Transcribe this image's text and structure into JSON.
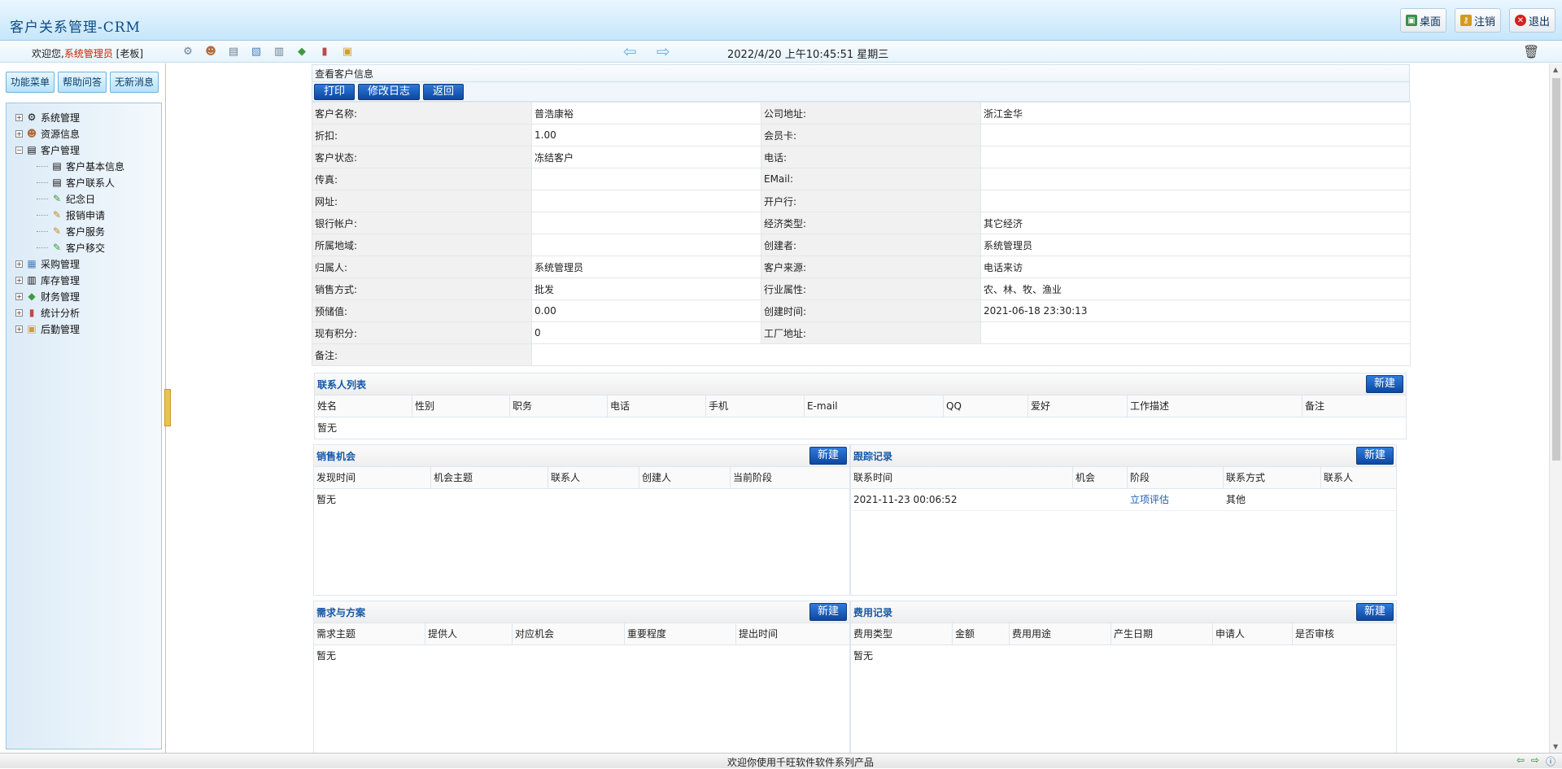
{
  "app": {
    "title": "客户关系管理-CRM"
  },
  "top_buttons": [
    {
      "label": "桌面",
      "icon": "desktop-icon",
      "color": "#2a7f3a"
    },
    {
      "label": "注销",
      "icon": "key-icon",
      "color": "#c98a12"
    },
    {
      "label": "退出",
      "icon": "close-icon",
      "color": "#d42020"
    }
  ],
  "status": {
    "welcome_prefix": "欢迎您,",
    "user": "系统管理员",
    "role": "[老板]",
    "datetime": "2022/4/20 上午10:45:51 星期三",
    "quick_icons": [
      "gear-icon",
      "user-icon",
      "card-icon",
      "chart-icon",
      "printer-icon",
      "money-icon",
      "stats-icon",
      "box-icon"
    ]
  },
  "left_tabs": [
    "功能菜单",
    "帮助问答",
    "无新消息"
  ],
  "tree": [
    {
      "label": "系统管理",
      "icon": "⚙",
      "expanded": false
    },
    {
      "label": "资源信息",
      "icon": "👤",
      "expanded": false
    },
    {
      "label": "客户管理",
      "icon": "▤",
      "expanded": true
    },
    {
      "label": "客户基本信息",
      "icon": "▤",
      "child": true
    },
    {
      "label": "客户联系人",
      "icon": "▤",
      "child": true
    },
    {
      "label": "纪念日",
      "icon": "✎",
      "child": true
    },
    {
      "label": "报销申请",
      "icon": "✎",
      "child": true
    },
    {
      "label": "客户服务",
      "icon": "✎",
      "child": true
    },
    {
      "label": "客户移交",
      "icon": "✎",
      "child": true
    },
    {
      "label": "采购管理",
      "icon": "▦",
      "expanded": false
    },
    {
      "label": "库存管理",
      "icon": "▥",
      "expanded": false
    },
    {
      "label": "财务管理",
      "icon": "◆",
      "expanded": false
    },
    {
      "label": "统计分析",
      "icon": "▮",
      "expanded": false
    },
    {
      "label": "后勤管理",
      "icon": "▣",
      "expanded": false
    }
  ],
  "panel": {
    "title": "查看客户信息",
    "buttons": [
      "打印",
      "修改日志",
      "返回"
    ]
  },
  "info_rows": [
    {
      "k1": "客户名称:",
      "v1": "普浩康裕",
      "k2": "公司地址:",
      "v2": "浙江金华"
    },
    {
      "k1": "折扣:",
      "v1": "1.00",
      "k2": "会员卡:",
      "v2": ""
    },
    {
      "k1": "客户状态:",
      "v1": "冻结客户",
      "k2": "电话:",
      "v2": ""
    },
    {
      "k1": "传真:",
      "v1": "",
      "k2": "EMail:",
      "v2": ""
    },
    {
      "k1": "网址:",
      "v1": "",
      "k2": "开户行:",
      "v2": ""
    },
    {
      "k1": "银行帐户:",
      "v1": "",
      "k2": "经济类型:",
      "v2": "其它经济"
    },
    {
      "k1": "所属地域:",
      "v1": "",
      "k2": "创建者:",
      "v2": "系统管理员"
    },
    {
      "k1": "归属人:",
      "v1": "系统管理员",
      "k2": "客户来源:",
      "v2": "电话来访"
    },
    {
      "k1": "销售方式:",
      "v1": "批发",
      "k2": "行业属性:",
      "v2": "农、林、牧、渔业"
    },
    {
      "k1": "预储值:",
      "v1": "0.00",
      "k2": "创建时间:",
      "v2": "2021-06-18 23:30:13"
    },
    {
      "k1": "现有积分:",
      "v1": "0",
      "k2": "工厂地址:",
      "v2": ""
    }
  ],
  "remark_label": "备注:",
  "contacts": {
    "title": "联系人列表",
    "new_label": "新建",
    "columns": [
      "姓名",
      "性别",
      "职务",
      "电话",
      "手机",
      "E-mail",
      "QQ",
      "爱好",
      "工作描述",
      "备注"
    ],
    "empty": "暂无"
  },
  "sales": {
    "title": "销售机会",
    "new_label": "新建",
    "columns": [
      "发现时间",
      "机会主题",
      "联系人",
      "创建人",
      "当前阶段"
    ],
    "empty": "暂无"
  },
  "tracking": {
    "title": "跟踪记录",
    "new_label": "新建",
    "columns": [
      "联系时间",
      "机会",
      "阶段",
      "联系方式",
      "联系人"
    ],
    "rows": [
      [
        "2021-11-23 00:06:52",
        "",
        "立项评估",
        "其他",
        ""
      ]
    ]
  },
  "needs": {
    "title": "需求与方案",
    "new_label": "新建",
    "columns": [
      "需求主题",
      "提供人",
      "对应机会",
      "重要程度",
      "提出时间"
    ],
    "empty": "暂无"
  },
  "fees": {
    "title": "费用记录",
    "new_label": "新建",
    "columns": [
      "费用类型",
      "金额",
      "费用用途",
      "产生日期",
      "申请人",
      "是否审核"
    ],
    "empty": "暂无"
  },
  "footer": {
    "text": "欢迎你使用千旺软件软件系列产品"
  }
}
